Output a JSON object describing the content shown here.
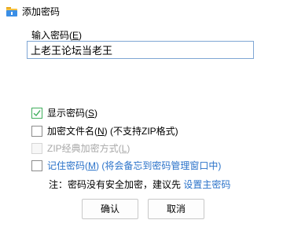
{
  "window": {
    "title": "添加密码",
    "icon": "folder-key-icon"
  },
  "password_field": {
    "label_text": "输入密码(",
    "label_key": "E",
    "label_close": ")",
    "value": "上老王论坛当老王"
  },
  "options": {
    "show_password": {
      "text": "显示密码(",
      "key": "S",
      "close": ")",
      "checked": true
    },
    "encrypt_filenames": {
      "text": "加密文件名(",
      "key": "N",
      "close": ") (不支持ZIP格式)",
      "checked": false
    },
    "zip_legacy": {
      "text": "ZIP经典加密方式(",
      "key": "L",
      "close": ")",
      "checked": false,
      "disabled": true
    },
    "remember_password": {
      "text": "记住密码(",
      "key": "M",
      "close": ") (将会备忘到密码管理窗口中)",
      "checked": false
    }
  },
  "note": {
    "text": "注：密码没有安全加密，建议先 ",
    "link": "设置主密码"
  },
  "buttons": {
    "ok": "确认",
    "cancel": "取消"
  },
  "colors": {
    "link": "#2a72c9",
    "check": "#3fae5c",
    "input_border": "#7fa6d4"
  }
}
